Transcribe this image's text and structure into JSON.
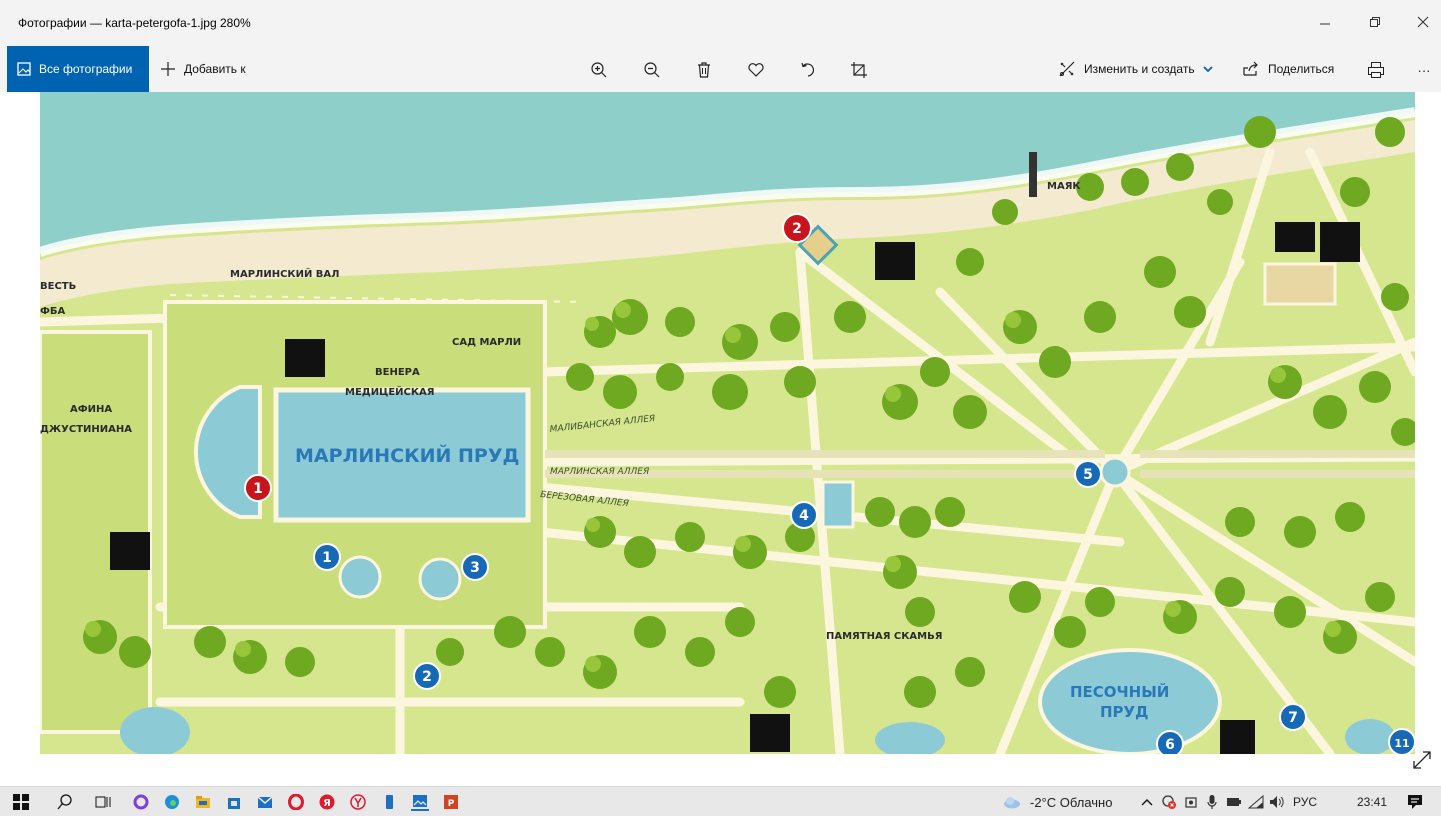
{
  "window": {
    "title": "Фотографии — karta-petergofa-1.jpg   280%"
  },
  "toolbar": {
    "all_photos_label": "Все фотографии",
    "add_to_label": "Добавить к",
    "edit_create_label": "Изменить и создать",
    "share_label": "Поделиться",
    "more_label": "···"
  },
  "map_labels": {
    "marly_pond": "МАРЛИНСКИЙ ПРУД",
    "marly_val": "МАРЛИНСКИЙ ВАЛ",
    "sad_marly": "САД МАРЛИ",
    "venus": "ВЕНЕРА",
    "medici": "МЕДИЦЕЙСКАЯ",
    "athena": "АФИНА",
    "justiniani": "ДЖУСТИНИАНА",
    "mayak": "МАЯК",
    "malibu_alley": "МАЛИБАНСКАЯ АЛЛЕЯ",
    "marly_alley": "МАРЛИНСКАЯ АЛЛЕЯ",
    "birch_alley": "БЕРЕЗОВАЯ АЛЛЕЯ",
    "memorial_bench": "ПАМЯТНАЯ СКАМЬЯ",
    "sand_pond_1": "ПЕСОЧНЫЙ",
    "sand_pond_2": "ПРУД",
    "edge_1": "ВЕСТЬ",
    "edge_2": "ФБА",
    "markers": [
      "1",
      "2",
      "1",
      "2",
      "3",
      "4",
      "5",
      "6",
      "7",
      "11"
    ]
  },
  "taskbar": {
    "weather": "-2°C  Облачно",
    "language": "РУС",
    "time": "23:41"
  },
  "colors": {
    "accent": "#0063b1",
    "sea": "#8fcfc9",
    "sand": "#f3ead0",
    "park": "#d6e68f",
    "path": "#fbf6dd",
    "pond": "#8ccbd6",
    "tree": "#6fa821",
    "marker_blue": "#1769b6",
    "marker_red": "#c8141c"
  }
}
